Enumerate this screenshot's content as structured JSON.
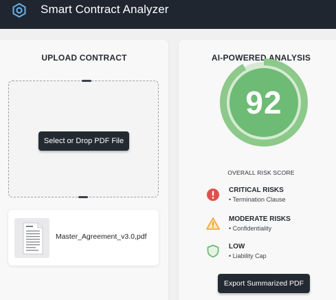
{
  "header": {
    "title": "Smart Contract Analyzer",
    "logo_icon": "hexagon-logo-icon",
    "background": "#1f2630"
  },
  "upload": {
    "title": "UPLOAD CONTRACT",
    "select_button": "Select or Drop PDF File",
    "file": {
      "name": "Master_Agreement_v3.0,pdf",
      "icon": "document-thumbnail-icon"
    }
  },
  "analysis": {
    "title": "AI-POWERED ANALYSIS",
    "score": "92",
    "score_value": 92,
    "score_label": "OVERALL RISK SCORE",
    "score_color": "#6dbb74",
    "risks": [
      {
        "title": "CRITICAL RISKS",
        "item": "• Termination Clause",
        "icon": "exclamation-circle-icon",
        "color": "#e0514b"
      },
      {
        "title": "MODERATE RISKS",
        "item": "• Confidentiality",
        "icon": "warning-triangle-icon",
        "color": "#f2a93b"
      },
      {
        "title": "LOW",
        "item": "• Liability Cap",
        "icon": "shield-check-icon",
        "color": "#6dbb74"
      }
    ],
    "export_button": "Export Summarized PDF"
  }
}
